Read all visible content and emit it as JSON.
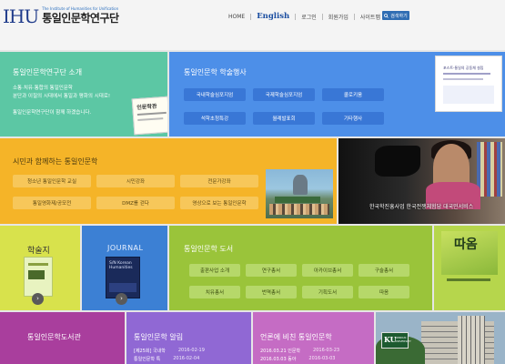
{
  "header": {
    "logo_mark": "IHU",
    "logo_en": "The Institute of Humanities for Unification",
    "logo_ko": "통일인문학연구단",
    "nav": [
      "HOME",
      "English",
      "로그인",
      "회원가입",
      "사이트맵"
    ],
    "search_label": "검색하기"
  },
  "intro": {
    "title": "통일인문학연구단 소개",
    "desc_lines": [
      "소통·치유·통합의 통일인문학",
      "분단과 이질의 시대에서 통일과 평화의 시대로!"
    ],
    "desc2": "통일인문학연구단이 함께 하겠습니다.",
    "book_title": "인문학관"
  },
  "events": {
    "title": "통일인문학 학술행사",
    "buttons": [
      "국내학술심포지엄",
      "국제학술심포지엄",
      "콜로키움",
      "석학초청특강",
      "월례발표회",
      "기타행사"
    ],
    "doc_title": "포스트-통일의 공동체 설립"
  },
  "citizens": {
    "title": "시민과 함께하는 통일인문학",
    "buttons": [
      "청소년 통일인문학 교실",
      "시민강좌",
      "전문가강좌",
      "통일영화제/공모전",
      "DMZ를 걷다",
      "영상으로 보는 통일인문학"
    ]
  },
  "photo_caption": "한국학진흥사업 한국전쟁체험담 대국민서비스",
  "journal_tile": {
    "title": "학술지"
  },
  "journal_en": {
    "title": "JOURNAL",
    "book_lines": [
      "S/N Korean",
      "Humanities"
    ]
  },
  "books": {
    "title": "통일인문학 도서",
    "buttons": [
      "출판사업 소개",
      "연구총서",
      "아카이브총서",
      "구술총서",
      "치유총서",
      "번역총서",
      "기획도서",
      "따옴"
    ]
  },
  "cover_title": "따옴",
  "bottom": {
    "library": {
      "title": "통일인문학도서관"
    },
    "notice": {
      "title": "통일인문학 알림",
      "items": [
        {
          "text": "[제25회] 국내학",
          "date": "2016-02-19"
        },
        {
          "text": "통일인문학 특",
          "date": "2016-02-04"
        }
      ]
    },
    "press": {
      "title": "언론에 비친 통일인문학",
      "items": [
        {
          "text": "2016.03.21 인문학",
          "date": "2016-03-23"
        },
        {
          "text": "2016.03.03 동아",
          "date": "2016-03-03"
        }
      ]
    },
    "ku_logo": {
      "mark": "KU",
      "text": [
        "KONKUK",
        "UNIVERSITY"
      ]
    }
  },
  "colors": {
    "green": "#5cc7a4",
    "blue": "#4d8fe8",
    "yellow": "#f5b428",
    "lime": "#d8e24c",
    "journal_blue": "#3c80d4",
    "olive": "#9ac43a",
    "purple": "#a93e9d",
    "lilac": "#9068d4",
    "pink": "#c56cc4"
  },
  "icons": [
    "magnifier-icon",
    "arrow-right-icon"
  ]
}
